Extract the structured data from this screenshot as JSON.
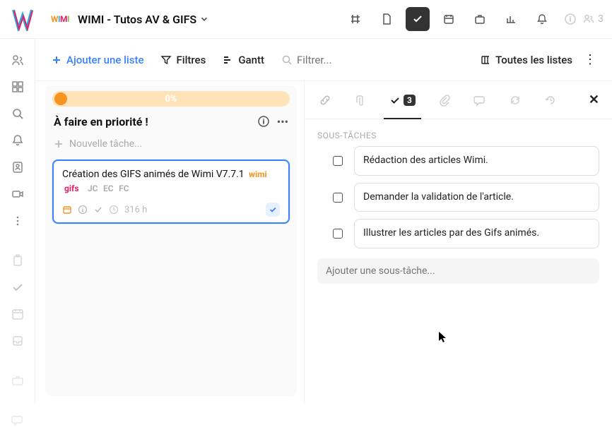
{
  "header": {
    "project_title": "WIMI - Tutos AV & GIFS",
    "member_count": "3"
  },
  "toolbar": {
    "add_list": "Ajouter une liste",
    "filters": "Filtres",
    "gantt": "Gantt",
    "search_placeholder": "Filtrer...",
    "all_lists": "Toutes les listes"
  },
  "list": {
    "progress": "0%",
    "title": "À faire en priorité !",
    "new_task_placeholder": "Nouvelle tâche...",
    "task": {
      "title": "Création des GIFS animés de Wimi V7.7.1",
      "tag_wimi": "wimi",
      "tag_gifs": "gifs",
      "assignees": [
        "JC",
        "EC",
        "FC"
      ],
      "hours": "316 h"
    }
  },
  "detail": {
    "subtasks_count": "3",
    "section_title": "SOUS-TÂCHES",
    "subtasks": [
      "Rédaction des articles Wimi.",
      "Demander la validation de l'article.",
      "Illustrer les articles par des Gifs animés."
    ],
    "add_subtask_placeholder": "Ajouter une sous-tâche..."
  }
}
